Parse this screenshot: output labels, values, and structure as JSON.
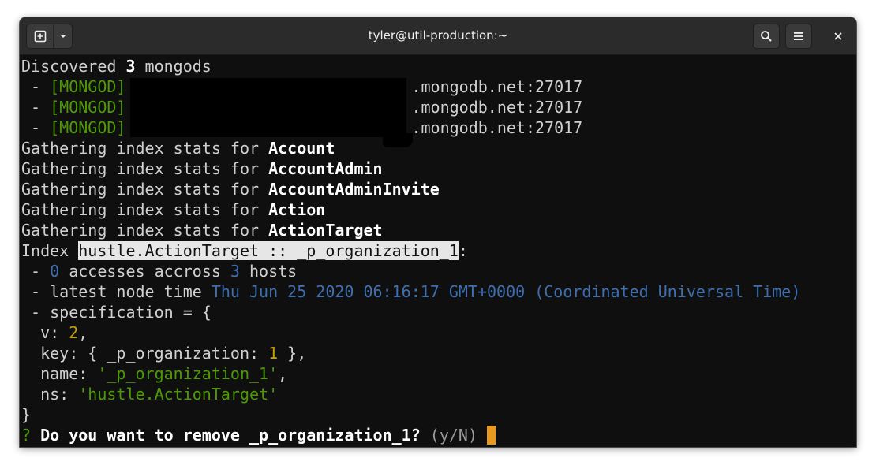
{
  "window": {
    "title": "tyler@util-production:~"
  },
  "icons": {
    "new_tab": "new-tab-icon",
    "dropdown": "chevron-down-icon",
    "search": "search-icon",
    "menu": "hamburger-menu-icon",
    "close": "close-icon"
  },
  "colors": {
    "green": "#4e9a06",
    "blue": "#3f6fb0",
    "yellow": "#c4a000",
    "cursor": "#e69a22",
    "highlight": "#e6e6e6"
  },
  "terminal": {
    "discovered": {
      "prefix": "Discovered ",
      "count": "3",
      "suffix": " mongods"
    },
    "mongods": [
      {
        "bullet": " - ",
        "tag": "[MONGOD]",
        "host_suffix": ".mongodb.net:27017"
      },
      {
        "bullet": " - ",
        "tag": "[MONGOD]",
        "host_suffix": ".mongodb.net:27017"
      },
      {
        "bullet": " - ",
        "tag": "[MONGOD]",
        "host_suffix": ".mongodb.net:27017"
      }
    ],
    "gathering": [
      {
        "prefix": "Gathering index stats for ",
        "name": "Account"
      },
      {
        "prefix": "Gathering index stats for ",
        "name": "AccountAdmin"
      },
      {
        "prefix": "Gathering index stats for ",
        "name": "AccountAdminInvite"
      },
      {
        "prefix": "Gathering index stats for ",
        "name": "Action"
      },
      {
        "prefix": "Gathering index stats for ",
        "name": "ActionTarget"
      }
    ],
    "index_line": {
      "prefix": "Index ",
      "name": "hustle.ActionTarget :: _p_organization_1",
      "suffix": ":"
    },
    "accesses": {
      "bullet": " - ",
      "count": "0",
      "mid": " accesses accross ",
      "hosts": "3",
      "suffix": " hosts"
    },
    "latest": {
      "prefix": " - latest node time ",
      "time": "Thu Jun 25 2020 06:16:17 GMT+0000 (Coordinated Universal Time)"
    },
    "spec": {
      "header": " - specification = {",
      "v_key": "  v: ",
      "v_val": "2",
      "v_end": ",",
      "key_prefix": "  key: { _p_organization: ",
      "key_val": "1",
      "key_end": " },",
      "name_key": "  name: ",
      "name_val": "'_p_organization_1'",
      "name_end": ",",
      "ns_key": "  ns: ",
      "ns_val": "'hustle.ActionTarget'",
      "close": "}"
    },
    "prompt": {
      "mark": "?",
      "question": " Do you want to remove _p_organization_1?",
      "hint": " (y/N)"
    }
  }
}
